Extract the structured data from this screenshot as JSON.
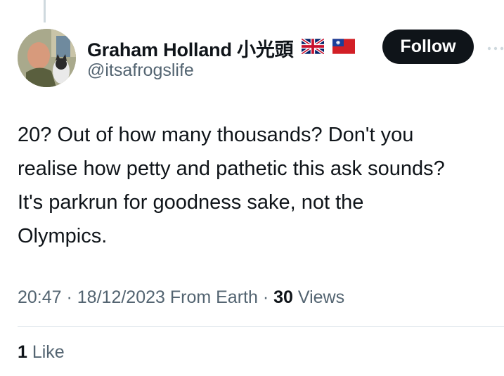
{
  "author": {
    "name": "Graham Holland 小光頭",
    "handle": "@itsafrogslife",
    "flags": [
      "uk-flag-icon",
      "taiwan-flag-icon"
    ]
  },
  "actions": {
    "follow_label": "Follow",
    "more_icon": "more-icon"
  },
  "tweet": {
    "lines": [
      "20? Out of how many thousands? Don't you",
      "realise how petty and pathetic this ask sounds?",
      "It's parkrun for goodness sake, not the",
      "Olympics."
    ]
  },
  "meta": {
    "time": "20:47",
    "sep1": " · ",
    "date": "18/12/2023",
    "source": " From Earth",
    "sep2": " · ",
    "views_count": "30",
    "views_label": " Views"
  },
  "engagement": {
    "likes_count": "1",
    "likes_label": " Like"
  },
  "colors": {
    "text": "#0f1419",
    "secondary": "#536471",
    "follow_bg": "#0f1419",
    "divider": "#e6ecf0"
  }
}
